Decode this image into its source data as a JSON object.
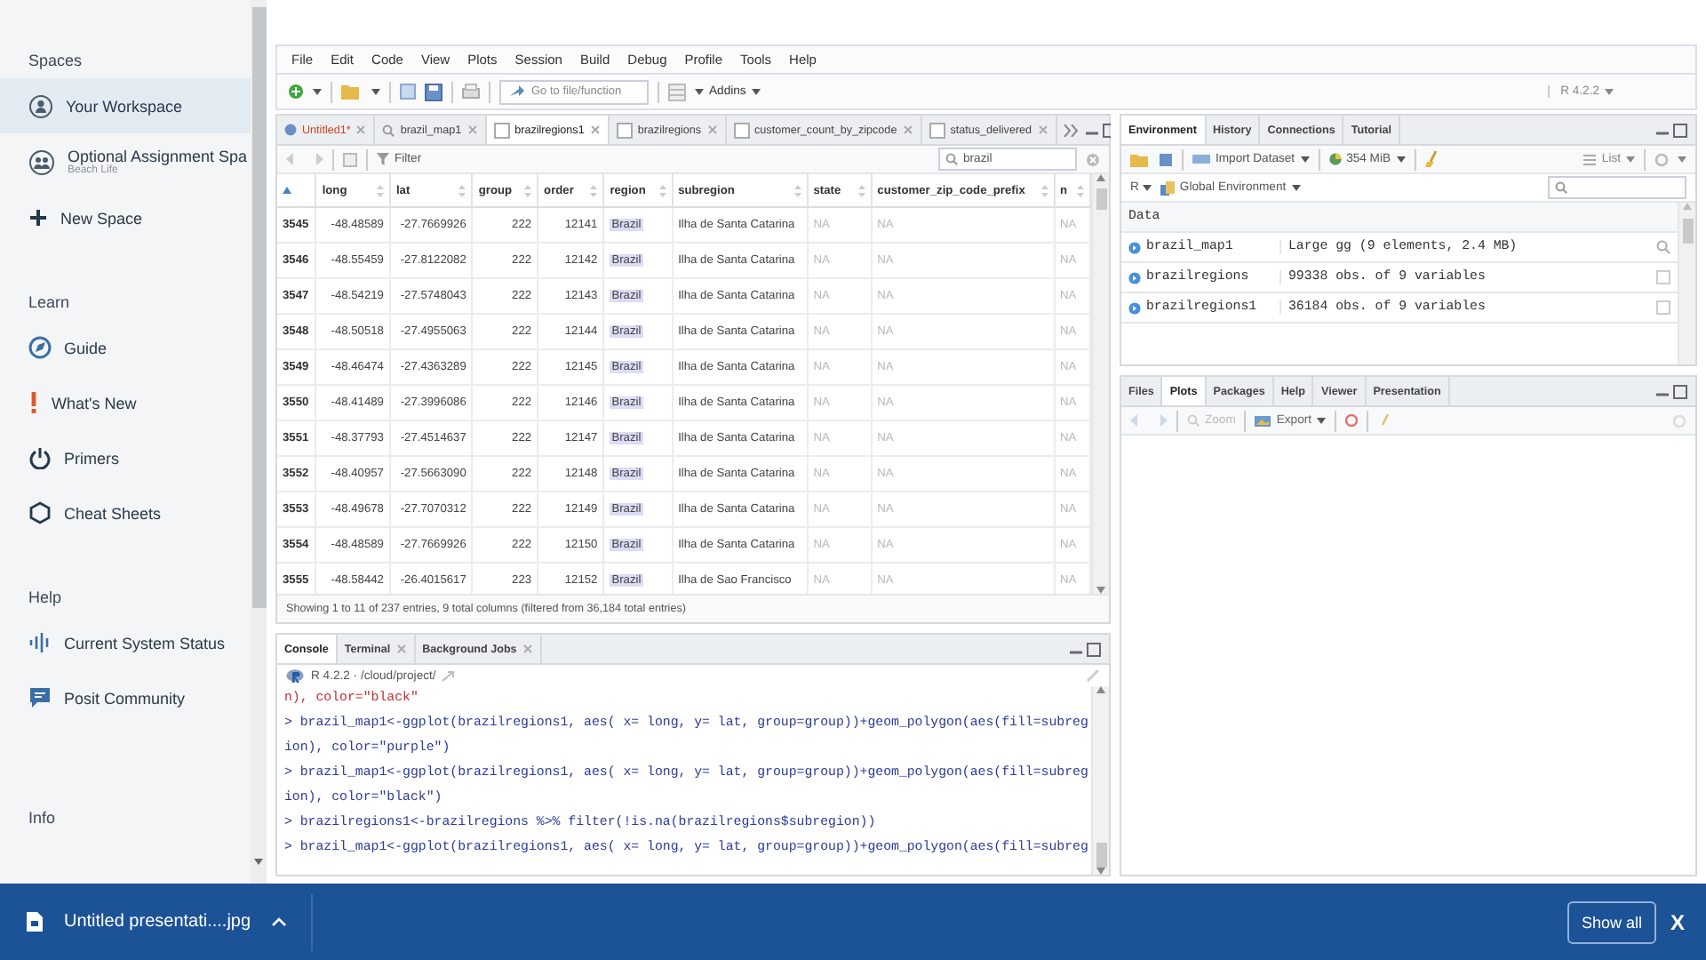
{
  "sidebar": {
    "sections": [
      {
        "heading": "Spaces",
        "items": [
          {
            "label": "Your Workspace",
            "kind": "workspace",
            "selected": true
          },
          {
            "label": "Optional Assignment Spa",
            "sublabel": "Beach Life",
            "kind": "assignment",
            "selected": false
          },
          {
            "label": "New Space",
            "kind": "new",
            "selected": false
          }
        ]
      },
      {
        "heading": "Learn",
        "items": [
          {
            "label": "Guide",
            "kind": "guide",
            "selected": false
          },
          {
            "label": "What's New",
            "kind": "news",
            "selected": false
          },
          {
            "label": "Primers",
            "kind": "primers",
            "selected": false
          },
          {
            "label": "Cheat Sheets",
            "kind": "sheets",
            "selected": false
          }
        ]
      },
      {
        "heading": "Help",
        "items": [
          {
            "label": "Current System Status",
            "kind": "status",
            "selected": false
          },
          {
            "label": "Posit Community",
            "kind": "community",
            "selected": false
          }
        ]
      },
      {
        "heading": "Info"
      }
    ]
  },
  "menu": [
    "File",
    "Edit",
    "Code",
    "View",
    "Plots",
    "Session",
    "Build",
    "Debug",
    "Profile",
    "Tools",
    "Help"
  ],
  "toolbar": {
    "goto_placeholder": "Go to file/function",
    "addins": "Addins",
    "r_version": "R 4.2.2"
  },
  "source": {
    "tabs": [
      {
        "label": "Untitled1*",
        "kind": "script",
        "modified": true,
        "selected": false
      },
      {
        "label": "brazil_map1",
        "kind": "viewer",
        "modified": false,
        "selected": false
      },
      {
        "label": "brazilregions1",
        "kind": "data",
        "modified": false,
        "selected": true
      },
      {
        "label": "brazilregions",
        "kind": "data",
        "modified": false,
        "selected": false
      },
      {
        "label": "customer_count_by_zipcode",
        "kind": "data",
        "modified": false,
        "selected": false
      },
      {
        "label": "status_delivered",
        "kind": "data",
        "modified": false,
        "selected": false
      }
    ],
    "filter_label": "Filter",
    "search_value": "brazil",
    "table": {
      "columns": [
        {
          "label": "long",
          "kind": "numeric"
        },
        {
          "label": "lat",
          "kind": "numeric"
        },
        {
          "label": "group",
          "kind": "numeric"
        },
        {
          "label": "order",
          "kind": "numeric"
        },
        {
          "label": "region",
          "kind": "matched"
        },
        {
          "label": "subregion",
          "kind": "text"
        },
        {
          "label": "state",
          "kind": "missing"
        },
        {
          "label": "customer_zip_code_prefix",
          "kind": "missing"
        },
        {
          "label": "n",
          "kind": "missing"
        }
      ],
      "rows": [
        {
          "index": "3545",
          "cells": [
            "-48.48589",
            "-27.7669926",
            "222",
            "12141",
            "Brazil",
            "Ilha de Santa Catarina",
            "NA",
            "NA",
            "NA"
          ]
        },
        {
          "index": "3546",
          "cells": [
            "-48.55459",
            "-27.8122082",
            "222",
            "12142",
            "Brazil",
            "Ilha de Santa Catarina",
            "NA",
            "NA",
            "NA"
          ]
        },
        {
          "index": "3547",
          "cells": [
            "-48.54219",
            "-27.5748043",
            "222",
            "12143",
            "Brazil",
            "Ilha de Santa Catarina",
            "NA",
            "NA",
            "NA"
          ]
        },
        {
          "index": "3548",
          "cells": [
            "-48.50518",
            "-27.4955063",
            "222",
            "12144",
            "Brazil",
            "Ilha de Santa Catarina",
            "NA",
            "NA",
            "NA"
          ]
        },
        {
          "index": "3549",
          "cells": [
            "-48.46474",
            "-27.4363289",
            "222",
            "12145",
            "Brazil",
            "Ilha de Santa Catarina",
            "NA",
            "NA",
            "NA"
          ]
        },
        {
          "index": "3550",
          "cells": [
            "-48.41489",
            "-27.3996086",
            "222",
            "12146",
            "Brazil",
            "Ilha de Santa Catarina",
            "NA",
            "NA",
            "NA"
          ]
        },
        {
          "index": "3551",
          "cells": [
            "-48.37793",
            "-27.4514637",
            "222",
            "12147",
            "Brazil",
            "Ilha de Santa Catarina",
            "NA",
            "NA",
            "NA"
          ]
        },
        {
          "index": "3552",
          "cells": [
            "-48.40957",
            "-27.5663090",
            "222",
            "12148",
            "Brazil",
            "Ilha de Santa Catarina",
            "NA",
            "NA",
            "NA"
          ]
        },
        {
          "index": "3553",
          "cells": [
            "-48.49678",
            "-27.7070312",
            "222",
            "12149",
            "Brazil",
            "Ilha de Santa Catarina",
            "NA",
            "NA",
            "NA"
          ]
        },
        {
          "index": "3554",
          "cells": [
            "-48.48589",
            "-27.7669926",
            "222",
            "12150",
            "Brazil",
            "Ilha de Santa Catarina",
            "NA",
            "NA",
            "NA"
          ]
        },
        {
          "index": "3555",
          "cells": [
            "-48.58442",
            "-26.4015617",
            "223",
            "12152",
            "Brazil",
            "Ilha de Sao Francisco",
            "NA",
            "NA",
            "NA"
          ]
        }
      ]
    },
    "footer": "Showing 1 to 11 of 237 entries, 9 total columns (filtered from 36,184 total entries)"
  },
  "console": {
    "tabs": [
      {
        "label": "Console",
        "closable": false,
        "selected": true
      },
      {
        "label": "Terminal",
        "closable": true,
        "selected": false
      },
      {
        "label": "Background Jobs",
        "closable": true,
        "selected": false
      }
    ],
    "header": "R 4.2.2 · /cloud/project/",
    "lines": [
      {
        "kind": "error",
        "text": "n), color=\"black\""
      },
      {
        "kind": "command",
        "text": "> brazil_map1<-ggplot(brazilregions1, aes( x= long, y= lat, group=group))+geom_polygon(aes(fill=subreg"
      },
      {
        "kind": "command",
        "text": "ion), color=\"purple\")"
      },
      {
        "kind": "command",
        "text": "> brazil_map1<-ggplot(brazilregions1, aes( x= long, y= lat, group=group))+geom_polygon(aes(fill=subreg"
      },
      {
        "kind": "command",
        "text": "ion), color=\"black\")"
      },
      {
        "kind": "command",
        "text": "> brazilregions1<-brazilregions %>% filter(!is.na(brazilregions$subregion))"
      },
      {
        "kind": "command",
        "text": "> brazil_map1<-ggplot(brazilregions1, aes( x= long, y= lat, group=group))+geom_polygon(aes(fill=subreg"
      }
    ]
  },
  "environment": {
    "tabs": [
      {
        "label": "Environment",
        "selected": true
      },
      {
        "label": "History",
        "selected": false
      },
      {
        "label": "Connections",
        "selected": false
      },
      {
        "label": "Tutorial",
        "selected": false
      }
    ],
    "import_label": "Import Dataset",
    "memory": "354 MiB",
    "view_mode": "List",
    "language": "R",
    "scope": "Global Environment",
    "section": "Data",
    "rows": [
      {
        "name": "brazil_map1",
        "value": "Large gg (9 elements,  2.4 MB)",
        "kind": "object"
      },
      {
        "name": "brazilregions",
        "value": "99338 obs. of 9 variables",
        "kind": "table"
      },
      {
        "name": "brazilregions1",
        "value": "36184 obs. of 9 variables",
        "kind": "table"
      }
    ]
  },
  "files": {
    "tabs": [
      {
        "label": "Files",
        "selected": false
      },
      {
        "label": "Plots",
        "selected": true
      },
      {
        "label": "Packages",
        "selected": false
      },
      {
        "label": "Help",
        "selected": false
      },
      {
        "label": "Viewer",
        "selected": false
      },
      {
        "label": "Presentation",
        "selected": false
      }
    ],
    "zoom_label": "Zoom",
    "export_label": "Export"
  },
  "downloads": {
    "file": "Untitled presentati....jpg",
    "show_all": "Show all",
    "close": "X"
  }
}
